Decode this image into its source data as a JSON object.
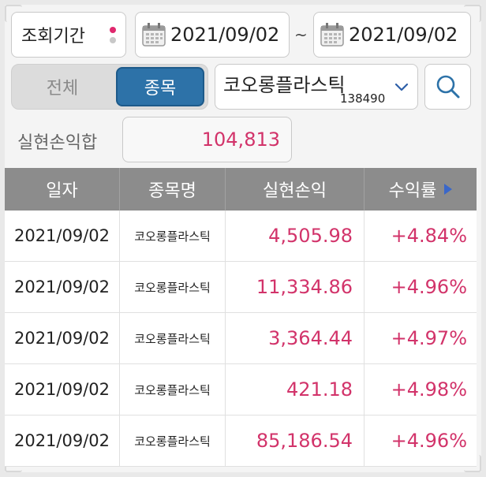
{
  "filters": {
    "period_label": "조회기간",
    "date_from": "2021/09/02",
    "separator": "~",
    "date_to": "2021/09/02"
  },
  "segment": {
    "all_label": "전체",
    "stock_label": "종목",
    "selected": "종목"
  },
  "stock": {
    "name": "코오롱플라스틱",
    "code": "138490"
  },
  "summary": {
    "label": "실현손익합",
    "value": "104,813"
  },
  "table": {
    "headers": [
      "일자",
      "종목명",
      "실현손익",
      "수익률"
    ],
    "rows": [
      {
        "date": "2021/09/02",
        "name": "코오롱플라스틱",
        "profit": "4,505.98",
        "rate": "+4.84%"
      },
      {
        "date": "2021/09/02",
        "name": "코오롱플라스틱",
        "profit": "11,334.86",
        "rate": "+4.96%"
      },
      {
        "date": "2021/09/02",
        "name": "코오롱플라스틱",
        "profit": "3,364.44",
        "rate": "+4.97%"
      },
      {
        "date": "2021/09/02",
        "name": "코오롱플라스틱",
        "profit": "421.18",
        "rate": "+4.98%"
      },
      {
        "date": "2021/09/02",
        "name": "코오롱플라스틱",
        "profit": "85,186.54",
        "rate": "+4.96%"
      }
    ]
  },
  "colors": {
    "accent": "#2d72a8",
    "positive": "#d2336a",
    "header_bg": "#8c8c8c"
  }
}
